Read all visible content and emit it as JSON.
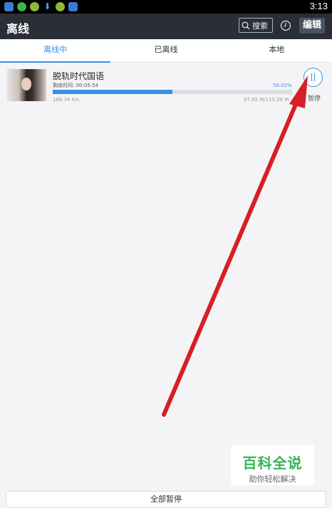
{
  "status_bar": {
    "time": "3:13"
  },
  "app_bar": {
    "title": "离线",
    "search_label": "搜索",
    "edit_label": "编辑"
  },
  "tabs": [
    {
      "label": "离线中",
      "active": true
    },
    {
      "label": "已离线",
      "active": false
    },
    {
      "label": "本地",
      "active": false
    }
  ],
  "download": {
    "title": "脱轨时代国语",
    "remaining": "剩余时间: 00:05:54",
    "percent_text": "50.02%",
    "progress": 0.5002,
    "speed": "166.34 K/s",
    "size": "57.65 M/115.26 M",
    "pause_label": "暂停"
  },
  "watermark": {
    "title": "百科全说",
    "subtitle": "助你轻松解决"
  },
  "bottom_button": {
    "label": "全部暂停"
  },
  "colors": {
    "accent": "#3a8ee6",
    "app_bar": "#2a2f37",
    "arrow": "#d61f26",
    "watermark_green": "#35b558"
  }
}
